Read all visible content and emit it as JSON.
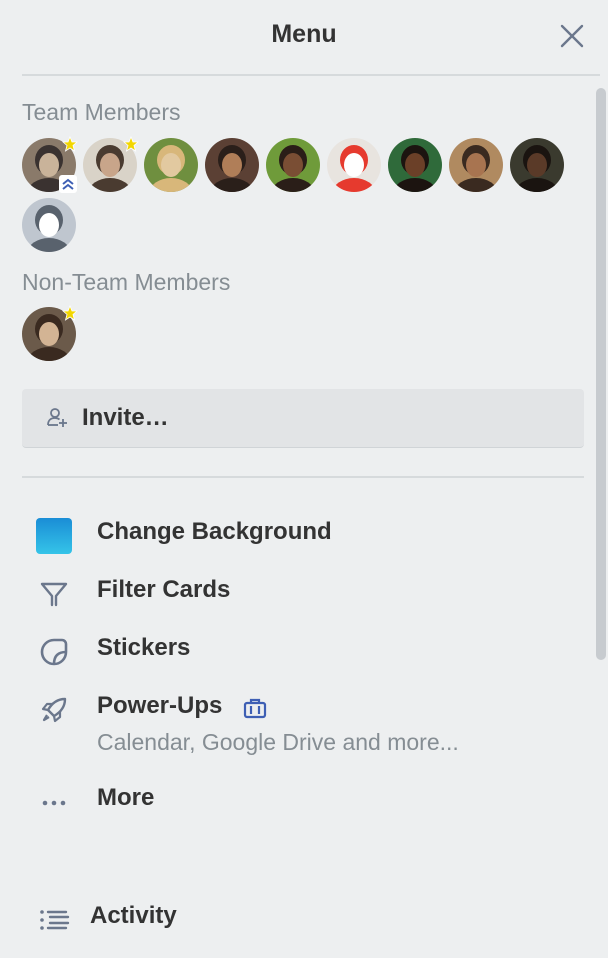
{
  "header": {
    "title": "Menu",
    "close_icon": "close-icon"
  },
  "team_members": {
    "label": "Team Members",
    "avatars": [
      {
        "name": "member-1",
        "admin": true,
        "chevrons": true,
        "colors": [
          "#8a7a6a",
          "#3a3230",
          "#c9b39a"
        ]
      },
      {
        "name": "member-2",
        "admin": true,
        "colors": [
          "#d9d3c8",
          "#4a3b30",
          "#c8a58a"
        ]
      },
      {
        "name": "member-3",
        "colors": [
          "#6f8f3f",
          "#d8b77a",
          "#e2c9a0"
        ]
      },
      {
        "name": "member-4",
        "colors": [
          "#5b4034",
          "#2a1f1a",
          "#b07e58"
        ]
      },
      {
        "name": "member-5",
        "colors": [
          "#6f9b3a",
          "#2a1e18",
          "#7a4e34"
        ]
      },
      {
        "name": "member-6",
        "colors": [
          "#e8e4df",
          "#e63a2e",
          "#ffffff"
        ]
      },
      {
        "name": "member-7",
        "colors": [
          "#2f6a3a",
          "#1c1410",
          "#6b4028"
        ]
      },
      {
        "name": "member-8",
        "colors": [
          "#b08a60",
          "#3a2a20",
          "#a87450"
        ]
      },
      {
        "name": "member-9",
        "colors": [
          "#3a3a2e",
          "#1a1410",
          "#5a3a28"
        ]
      },
      {
        "name": "member-10",
        "colors": [
          "#bfc6cf",
          "#59626d",
          "#ffffff"
        ]
      }
    ]
  },
  "non_team_members": {
    "label": "Non-Team Members",
    "avatars": [
      {
        "name": "non-member-1",
        "admin": true,
        "colors": [
          "#6b5a4a",
          "#3a2a20",
          "#d3b494"
        ]
      }
    ]
  },
  "invite": {
    "label": "Invite…",
    "icon": "add-person-icon"
  },
  "menu": {
    "change_background": "Change Background",
    "filter_cards": "Filter Cards",
    "stickers": "Stickers",
    "power_ups": "Power-Ups",
    "power_ups_sub": "Calendar, Google Drive and more...",
    "more": "More",
    "activity": "Activity"
  },
  "colors": {
    "accent_blue": "#1a8dd6",
    "business_icon": "#3e5fb4",
    "admin_star": "#f2d600"
  }
}
